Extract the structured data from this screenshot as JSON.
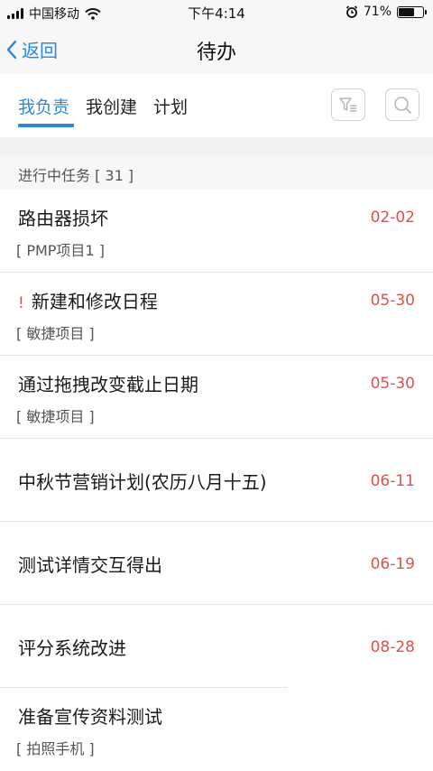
{
  "status_bar": {
    "carrier": "中国移动",
    "time": "下午4:14",
    "battery_percent": "71%",
    "battery_level": 0.71
  },
  "nav": {
    "back_label": "返回",
    "title": "待办"
  },
  "tabs": [
    {
      "label": "我负责",
      "active": true
    },
    {
      "label": "我创建",
      "active": false
    },
    {
      "label": "计划",
      "active": false
    }
  ],
  "icons": {
    "filter": "filter-icon",
    "search": "search-icon"
  },
  "section": {
    "header": "进行中任务 [ 31 ]"
  },
  "tasks": [
    {
      "title": "路由器损坏",
      "project": "[ PMP项目1 ]",
      "date": "02-02",
      "urgent": false
    },
    {
      "title": "新建和修改日程",
      "project": "[ 敏捷项目 ]",
      "date": "05-30",
      "urgent": true,
      "urgent_mark": "!"
    },
    {
      "title": "通过拖拽改变截止日期",
      "project": "[ 敏捷项目 ]",
      "date": "05-30",
      "urgent": false
    },
    {
      "title": "中秋节营销计划(农历八月十五)",
      "project": "",
      "date": "06-11",
      "urgent": false
    },
    {
      "title": "测试详情交互得出",
      "project": "",
      "date": "06-19",
      "urgent": false
    },
    {
      "title": "评分系统改进",
      "project": "",
      "date": "08-28",
      "urgent": false
    },
    {
      "title": "准备宣传资料测试",
      "project": "[ 拍照手机 ]",
      "date": "",
      "urgent": false
    }
  ],
  "colors": {
    "accent": "#2e86de",
    "date": "#d9534f"
  }
}
